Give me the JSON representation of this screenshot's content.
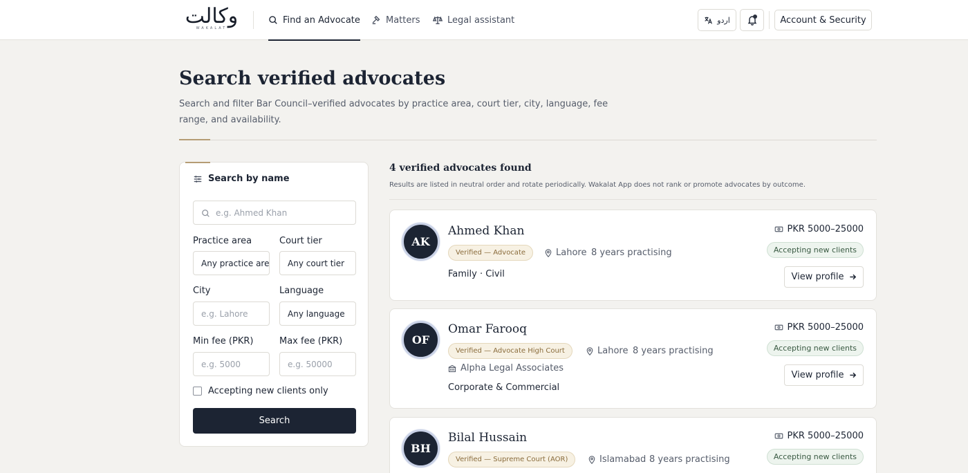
{
  "app": {
    "logo_text": "وکالت",
    "logo_sub": "WAKALAT"
  },
  "nav": {
    "links": [
      {
        "label": "Find an Advocate",
        "icon": "search-icon",
        "active": true
      },
      {
        "label": "Matters",
        "icon": "gavel-icon",
        "active": false
      },
      {
        "label": "Legal assistant",
        "icon": "scales-icon",
        "active": false
      }
    ],
    "language_label": "اردو",
    "account_label": "Account & Security"
  },
  "header": {
    "title": "Search verified advocates",
    "subtitle": "Search and filter Bar Council–verified advocates by practice area, court tier, city, language, fee range, and availability."
  },
  "filters": {
    "title": "Search by name",
    "name_placeholder": "e.g. Ahmed Khan",
    "practice_area_label": "Practice area",
    "practice_area_value": "Any practice area",
    "court_tier_label": "Court tier",
    "court_tier_value": "Any court tier",
    "city_label": "City",
    "city_placeholder": "e.g. Lahore",
    "language_label": "Language",
    "language_value": "Any language",
    "min_fee_label": "Min fee (PKR)",
    "min_fee_placeholder": "e.g. 5000",
    "max_fee_label": "Max fee (PKR)",
    "max_fee_placeholder": "e.g. 50000",
    "accepting_only_label": "Accepting new clients only",
    "search_label": "Search"
  },
  "results": {
    "count_label": "4 verified advocates found",
    "note": "Results are listed in neutral order and rotate periodically. Wakalat App does not rank or promote advocates by outcome.",
    "advocates": [
      {
        "initials": "AK",
        "name": "Ahmed Khan",
        "badge": "Verified — Advocate",
        "city": "Lahore",
        "experience": "8 years practising",
        "firm": "",
        "areas": "Family · Civil",
        "fee": "PKR 5000–25000",
        "status": "Accepting new clients",
        "cta": "View profile"
      },
      {
        "initials": "OF",
        "name": "Omar Farooq",
        "badge": "Verified — Advocate High Court",
        "city": "Lahore",
        "experience": "8 years practising",
        "firm": "Alpha Legal Associates",
        "areas": "Corporate & Commercial",
        "fee": "PKR 5000–25000",
        "status": "Accepting new clients",
        "cta": "View profile"
      },
      {
        "initials": "BH",
        "name": "Bilal Hussain",
        "badge": "Verified — Supreme Court (AOR)",
        "city": "Islamabad",
        "experience": "8 years practising",
        "firm": "",
        "areas": "",
        "fee": "PKR 5000–25000",
        "status": "Accepting new clients",
        "cta": "View profile"
      }
    ]
  },
  "colors": {
    "primary": "#1c2433",
    "accent_gold": "#b59c74",
    "background": "#f3f2ef",
    "accepting_green": "#edf4ee"
  }
}
